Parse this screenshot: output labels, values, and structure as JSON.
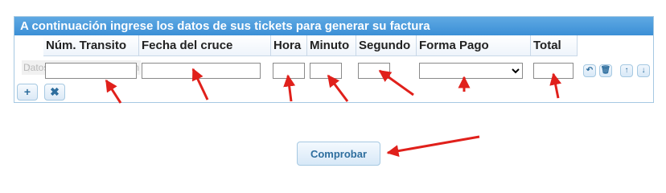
{
  "form": {
    "title": "A continuación ingrese los datos de sus tickets para generar su factura",
    "columns": [
      "Núm. Transito",
      "Fecha del cruce",
      "Hora",
      "Minuto",
      "Segundo",
      "Forma Pago",
      "Total"
    ],
    "row_placeholder": "Datos para la recuperación",
    "drag_glyph": "↑",
    "forma_pago_selected": "",
    "row_actions": [
      "↶",
      "🗑",
      "↑",
      "↓"
    ],
    "toolbar": {
      "add": "+",
      "delete": "✖"
    },
    "submit_label": "Comprobar"
  },
  "colors": {
    "title_bar": "#3b8fd6",
    "button_text": "#2e6e9e",
    "arrows": "#e0201b"
  }
}
